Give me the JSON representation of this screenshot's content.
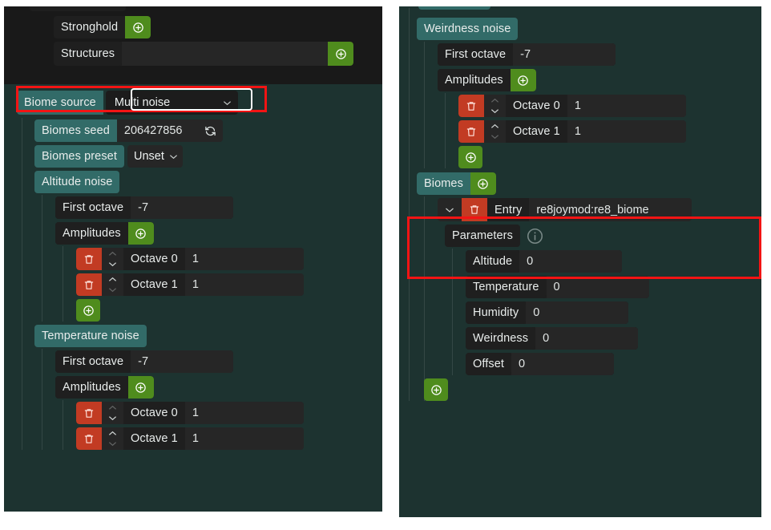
{
  "app": {
    "kind": "worldgen-dimension-editor",
    "accent_green": "#4f8c1d",
    "accent_red": "#c23b23",
    "accent_teal": "#326b68",
    "highlight_red": "#f21414",
    "panel_bg": "#1d3330",
    "dark_bg": "#191919"
  },
  "left_panel": {
    "structures_section": {
      "stronghold": {
        "label": "Stronghold",
        "add_icon": "plus-circle-icon"
      },
      "structures": {
        "label": "Structures",
        "value": "",
        "add_icon": "plus-circle-icon"
      }
    },
    "biome_source": {
      "label": "Biome source",
      "selected": "Multi noise",
      "caret_icon": "chevron-down-icon",
      "highlighted": true
    },
    "biomes_seed": {
      "label": "Biomes seed",
      "value": "206427856",
      "refresh_icon": "refresh-icon"
    },
    "biomes_preset": {
      "label": "Biomes preset",
      "selected": "Unset",
      "caret_icon": "chevron-down-icon"
    },
    "altitude_noise": {
      "label": "Altitude noise",
      "first_octave": {
        "label": "First octave",
        "value": "-7"
      },
      "amplitudes": {
        "label": "Amplitudes",
        "add_icon": "plus-circle-icon",
        "entries": [
          {
            "delete_icon": "trash-icon",
            "up_icon": "chevron-up-icon",
            "down_icon": "chevron-down-icon",
            "up_enabled": false,
            "down_enabled": true,
            "label": "Octave 0",
            "value": "1"
          },
          {
            "delete_icon": "trash-icon",
            "up_icon": "chevron-up-icon",
            "down_icon": "chevron-down-icon",
            "up_enabled": true,
            "down_enabled": false,
            "label": "Octave 1",
            "value": "1"
          }
        ],
        "add_entry_icon": "plus-circle-icon"
      }
    },
    "temperature_noise": {
      "label": "Temperature noise",
      "first_octave": {
        "label": "First octave",
        "value": "-7"
      },
      "amplitudes": {
        "label": "Amplitudes",
        "add_icon": "plus-circle-icon",
        "entries": [
          {
            "delete_icon": "trash-icon",
            "up_icon": "chevron-up-icon",
            "down_icon": "chevron-down-icon",
            "up_enabled": false,
            "down_enabled": true,
            "label": "Octave 0",
            "value": "1"
          },
          {
            "delete_icon": "trash-icon",
            "up_icon": "chevron-up-icon",
            "down_icon": "chevron-down-icon",
            "up_enabled": true,
            "down_enabled": false,
            "label": "Octave 1",
            "value": "1"
          }
        ]
      }
    }
  },
  "right_panel": {
    "weirdness_noise": {
      "label": "Weirdness noise",
      "first_octave": {
        "label": "First octave",
        "value": "-7"
      },
      "amplitudes": {
        "label": "Amplitudes",
        "add_icon": "plus-circle-icon",
        "entries": [
          {
            "delete_icon": "trash-icon",
            "up_icon": "chevron-up-icon",
            "down_icon": "chevron-down-icon",
            "up_enabled": false,
            "down_enabled": true,
            "label": "Octave 0",
            "value": "1"
          },
          {
            "delete_icon": "trash-icon",
            "up_icon": "chevron-up-icon",
            "down_icon": "chevron-down-icon",
            "up_enabled": true,
            "down_enabled": false,
            "label": "Octave 1",
            "value": "1"
          }
        ],
        "add_entry_icon": "plus-circle-icon"
      }
    },
    "biomes": {
      "label": "Biomes",
      "add_icon": "plus-circle-icon",
      "highlighted": true,
      "entry": {
        "collapse_icon": "chevron-down-icon",
        "delete_icon": "trash-icon",
        "label": "Entry",
        "value": "re8joymod:re8_biome",
        "highlighted": true
      },
      "parameters": {
        "label": "Parameters",
        "info_icon": "info-circle-icon",
        "fields": [
          {
            "label": "Altitude",
            "value": "0"
          },
          {
            "label": "Temperature",
            "value": "0"
          },
          {
            "label": "Humidity",
            "value": "0"
          },
          {
            "label": "Weirdness",
            "value": "0"
          },
          {
            "label": "Offset",
            "value": "0"
          }
        ]
      },
      "add_entry_icon": "plus-circle-icon"
    }
  }
}
